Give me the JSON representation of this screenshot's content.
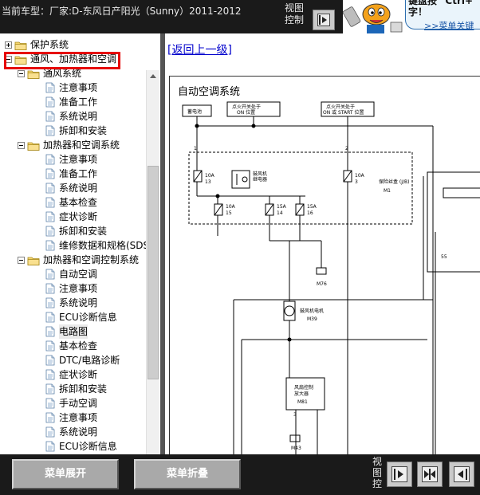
{
  "header": {
    "vehicle_title": "当前车型：厂家:D-东风日产阳光（Sunny）2011-2012",
    "view_control_label": "视图控制",
    "promo": {
      "text_line1": "键盘按 \"Ctrl+\"",
      "text_line2": "字！",
      "link": ">>菜单关键"
    }
  },
  "tree": {
    "items": [
      {
        "label": "保护系统",
        "level": 0,
        "type": "folder",
        "expander": "plus"
      },
      {
        "label": "通风、加热器和空调",
        "level": 0,
        "type": "folder",
        "expander": "minus"
      },
      {
        "label": "通风系统",
        "level": 1,
        "type": "folder",
        "expander": "minus"
      },
      {
        "label": "注意事项",
        "level": 2,
        "type": "doc"
      },
      {
        "label": "准备工作",
        "level": 2,
        "type": "doc"
      },
      {
        "label": "系统说明",
        "level": 2,
        "type": "doc"
      },
      {
        "label": "拆卸和安装",
        "level": 2,
        "type": "doc"
      },
      {
        "label": "加热器和空调系统",
        "level": 1,
        "type": "folder",
        "expander": "minus"
      },
      {
        "label": "注意事项",
        "level": 2,
        "type": "doc"
      },
      {
        "label": "准备工作",
        "level": 2,
        "type": "doc"
      },
      {
        "label": "系统说明",
        "level": 2,
        "type": "doc"
      },
      {
        "label": "基本检查",
        "level": 2,
        "type": "doc"
      },
      {
        "label": "症状诊断",
        "level": 2,
        "type": "doc"
      },
      {
        "label": "拆卸和安装",
        "level": 2,
        "type": "doc"
      },
      {
        "label": "维修数据和规格(SDS",
        "level": 2,
        "type": "doc"
      },
      {
        "label": "加热器和空调控制系统",
        "level": 1,
        "type": "folder",
        "expander": "minus"
      },
      {
        "label": "自动空调",
        "level": 2,
        "type": "doc"
      },
      {
        "label": "注意事项",
        "level": 2,
        "type": "doc"
      },
      {
        "label": "系统说明",
        "level": 2,
        "type": "doc"
      },
      {
        "label": "ECU诊断信息",
        "level": 2,
        "type": "doc"
      },
      {
        "label": "电路图",
        "level": 2,
        "type": "doc",
        "selected": true
      },
      {
        "label": "基本检查",
        "level": 2,
        "type": "doc"
      },
      {
        "label": "DTC/电路诊断",
        "level": 2,
        "type": "doc"
      },
      {
        "label": "症状诊断",
        "level": 2,
        "type": "doc"
      },
      {
        "label": "拆卸和安装",
        "level": 2,
        "type": "doc"
      },
      {
        "label": "手动空调",
        "level": 2,
        "type": "doc"
      },
      {
        "label": "注意事项",
        "level": 2,
        "type": "doc"
      },
      {
        "label": "系统说明",
        "level": 2,
        "type": "doc"
      },
      {
        "label": "ECU诊断信息",
        "level": 2,
        "type": "doc"
      }
    ]
  },
  "content": {
    "back_link": "[返回上一级]",
    "diagram": {
      "title": "自动空调系统",
      "labels": {
        "battery": "蓄电池",
        "ign_on": "点火开关处于",
        "ign_on2": "ON 位置",
        "ign_start": "点火开关处于",
        "ign_start2": "ON 或 START 位置",
        "fuse_10a_13": "10A",
        "fuse_13": "13",
        "relay": "鼓风机",
        "relay2": "继电器",
        "fuse_10a_3": "10A",
        "fuse_3": "3",
        "jb": "保险丝盒 (J/B)",
        "m1": "M1",
        "fuse_10a_15": "10A",
        "fuse_15": "15",
        "fuse_15a_14": "15A",
        "fuse_14": "14",
        "fuse_15a_16": "15A",
        "fuse_16": "16",
        "m76": "M76",
        "motor": "鼓风机电机",
        "m39": "M39",
        "amp1": "风扇控制",
        "amp2": "放大器",
        "m81": "M81",
        "m43": "M43",
        "pin1": "1",
        "pin2": "2",
        "pin3": "3",
        "pin55": "55"
      }
    }
  },
  "footer": {
    "expand_label": "菜单展开",
    "collapse_label": "菜单折叠",
    "view_control_label": "视图控"
  }
}
